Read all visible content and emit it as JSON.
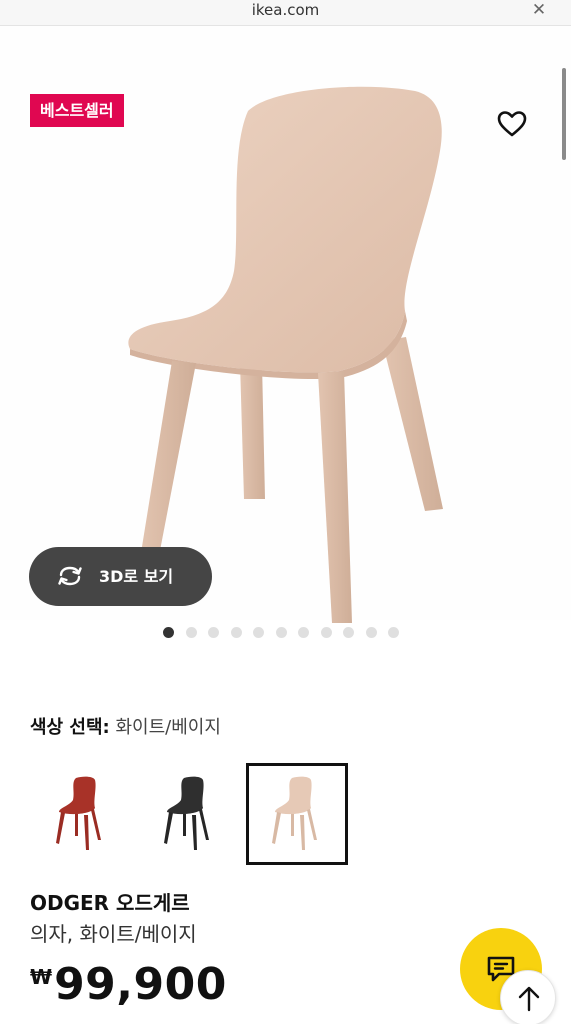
{
  "browser": {
    "url": "ikea.com",
    "close_icon": "close-icon"
  },
  "product": {
    "badge": "베스트셀러",
    "wishlist_icon": "heart-icon",
    "view3d": {
      "label": "3D로 보기",
      "icon": "rotate-3d-icon"
    },
    "gallery": {
      "total_images": 11,
      "active_index": 0
    },
    "color_select": {
      "label": "색상 선택:",
      "value": "화이트/베이지",
      "options": [
        {
          "name": "red",
          "color": "#a83228",
          "selected": false
        },
        {
          "name": "black",
          "color": "#2b2b2b",
          "selected": false
        },
        {
          "name": "white-beige",
          "color": "#e6c9b6",
          "selected": true
        }
      ]
    },
    "name": "ODGER 오드게르",
    "description": "의자, 화이트/베이지",
    "price_currency": "₩",
    "price_value": "99,900"
  },
  "floating": {
    "chat_icon": "chat-icon",
    "scroll_top_icon": "arrow-up-icon"
  },
  "colors": {
    "badge_bg": "#e00751",
    "chat_bg": "#f8d20f",
    "chair": "#e6c9b6"
  }
}
